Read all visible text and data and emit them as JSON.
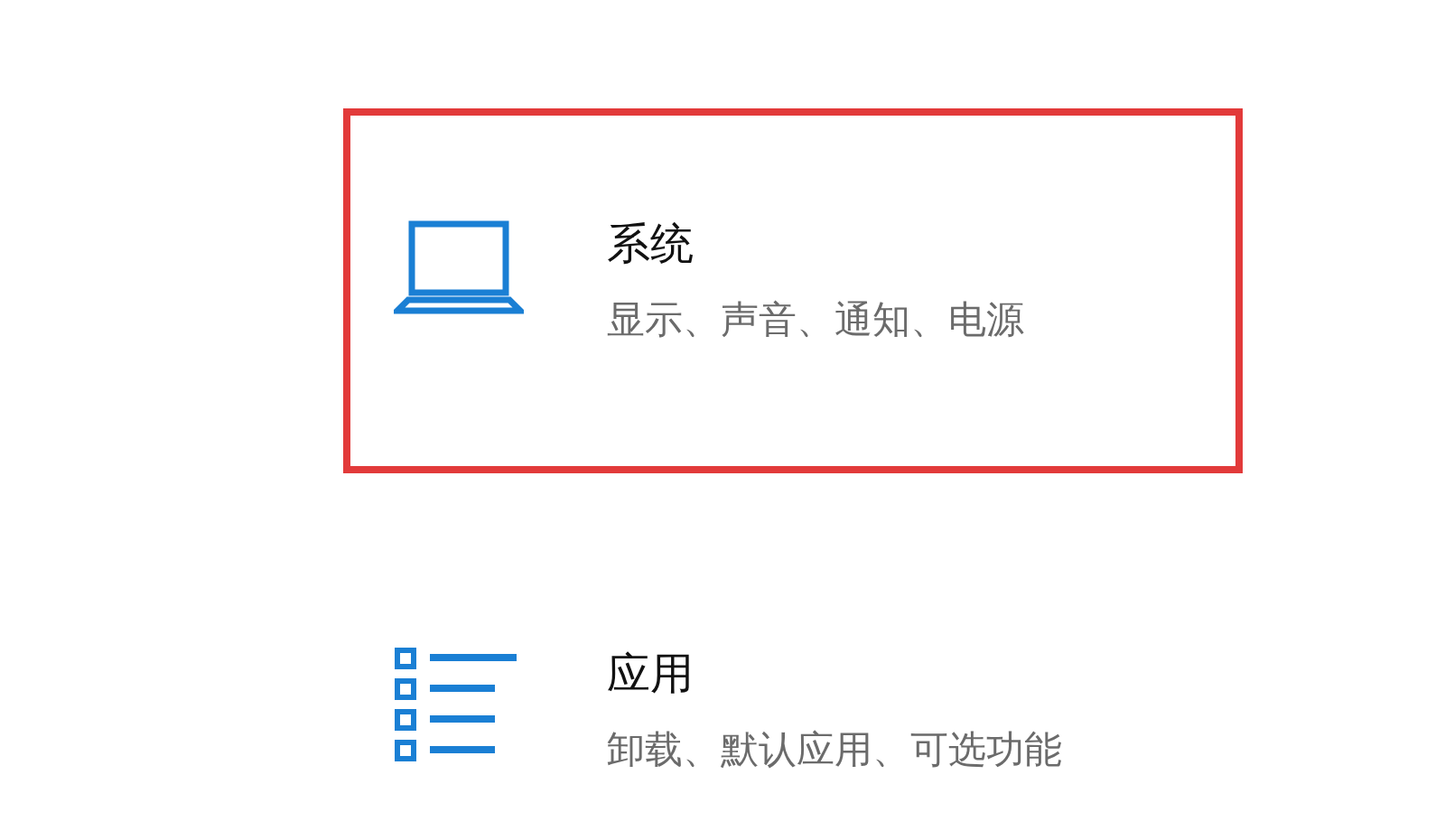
{
  "items": [
    {
      "kind": "laptop",
      "title": "系统",
      "subtitle": "显示、声音、通知、电源",
      "selected": true
    },
    {
      "kind": "list",
      "title": "应用",
      "subtitle": "卸载、默认应用、可选功能",
      "selected": false
    }
  ]
}
